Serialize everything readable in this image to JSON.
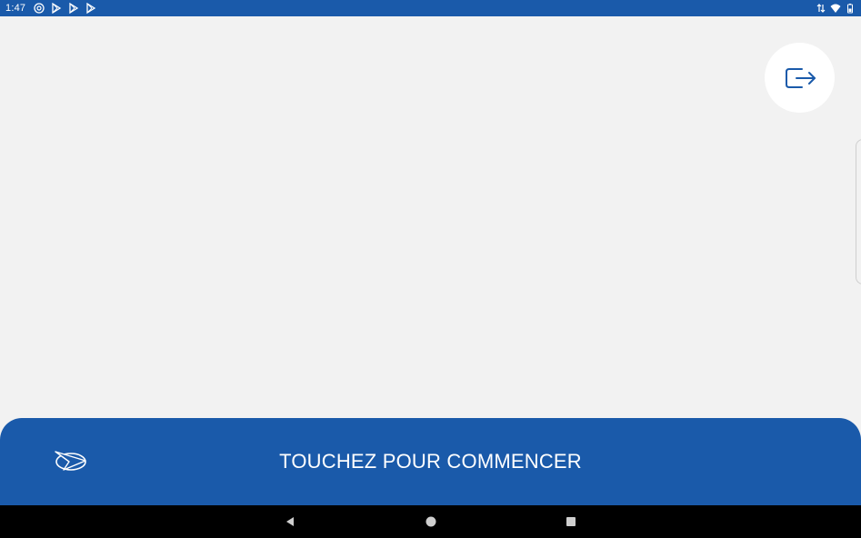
{
  "status_bar": {
    "time": "1:47",
    "left_icons": [
      "at-sign-icon",
      "play-store-icon",
      "play-store-icon",
      "play-store-icon"
    ],
    "right_icons": [
      "data-arrows-icon",
      "wifi-icon",
      "battery-icon"
    ]
  },
  "main": {
    "exit_button_icon": "logout-icon"
  },
  "start_bar": {
    "label": "TOUCHEZ POUR COMMENCER",
    "logo_icon": "airline-logo-icon"
  },
  "nav_bar": {
    "buttons": [
      "back-icon",
      "home-icon",
      "recents-icon"
    ]
  },
  "colors": {
    "brand_blue": "#1a5aaa",
    "background": "#f2f2f2",
    "white": "#ffffff"
  }
}
